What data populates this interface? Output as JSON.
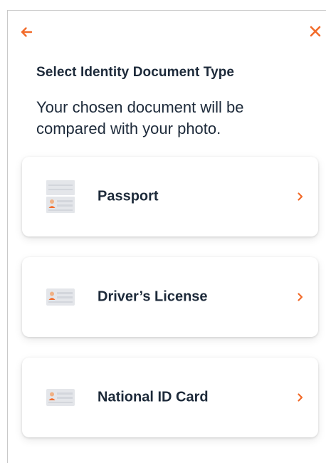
{
  "header": {
    "back_icon": "arrow-left-icon",
    "close_icon": "close-icon",
    "accent_color": "#f26b2a"
  },
  "title": "Select Identity Document Type",
  "subtitle": "Your chosen document will be compared with your photo.",
  "documents": [
    {
      "label": "Passport",
      "icon": "passport-icon"
    },
    {
      "label": "Driver’s License",
      "icon": "id-card-icon"
    },
    {
      "label": "National ID Card",
      "icon": "id-card-icon"
    }
  ],
  "colors": {
    "text": "#1d2a3a",
    "accent": "#f26b2a",
    "background": "#ffffff"
  }
}
